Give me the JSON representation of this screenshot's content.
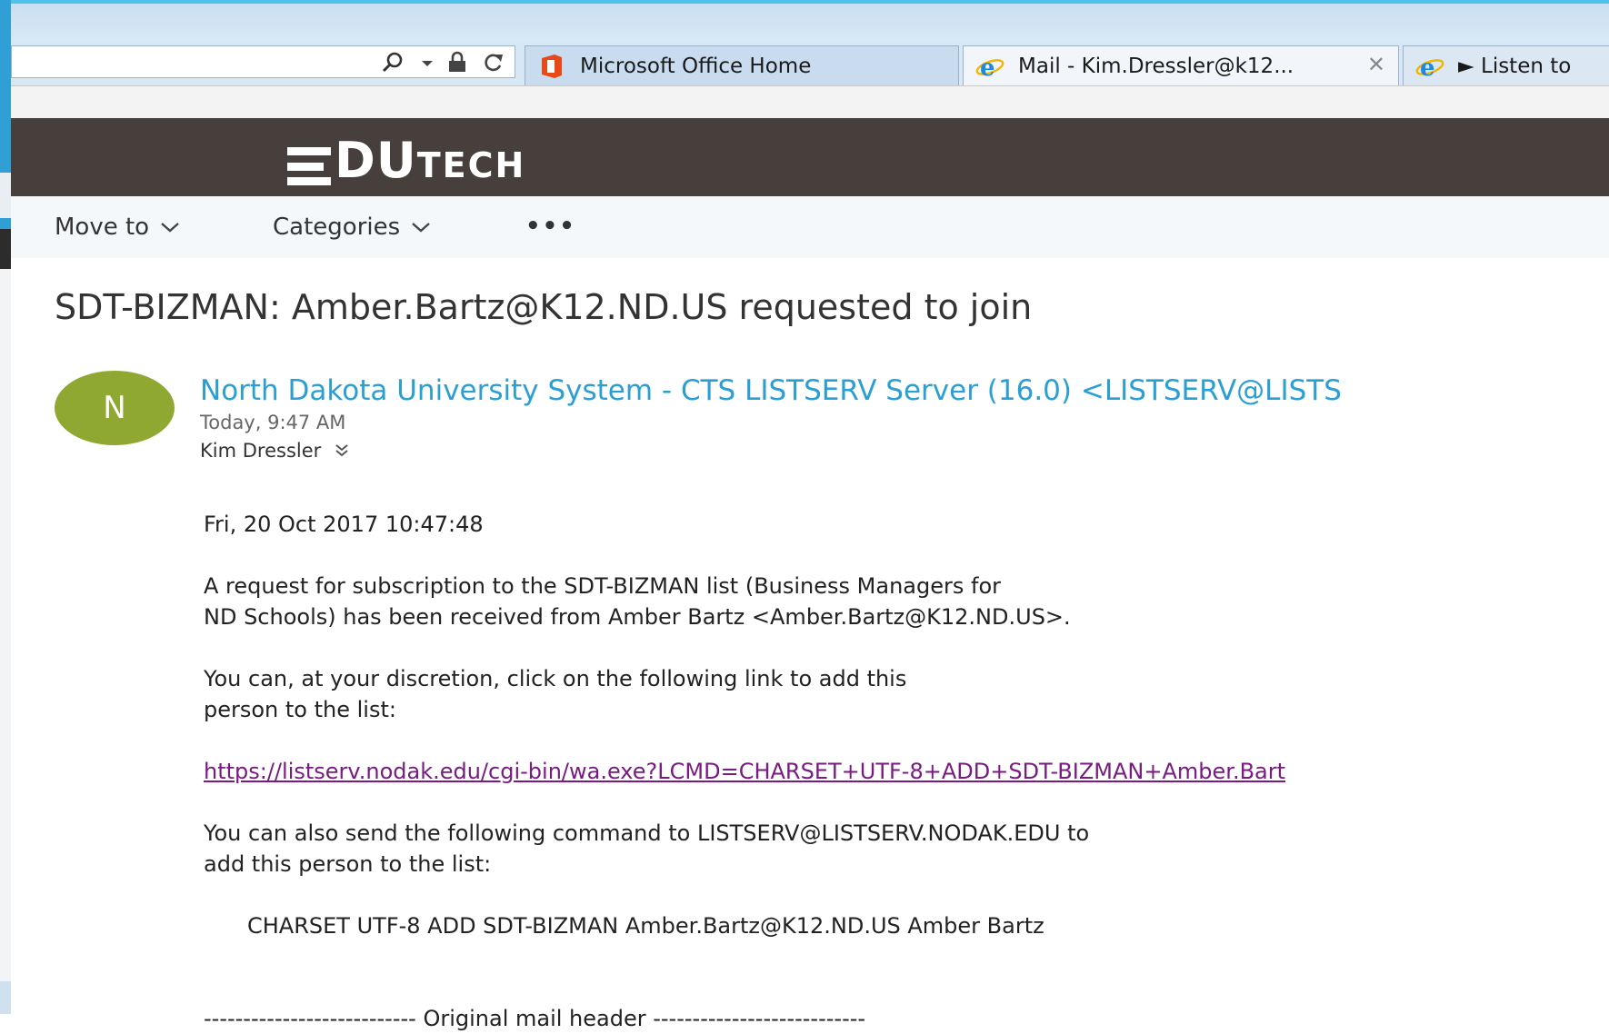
{
  "browser": {
    "tabs": [
      {
        "label": "Microsoft Office Home",
        "icon": "office-icon"
      },
      {
        "label": "Mail - Kim.Dressler@k12...",
        "icon": "ie-icon",
        "close": "✕"
      },
      {
        "label": "► Listen to",
        "icon": "ie-icon"
      }
    ]
  },
  "brand": {
    "logo_big": "DU",
    "logo_small": "TECH"
  },
  "toolbar": {
    "move_to": "Move to",
    "categories": "Categories",
    "more": "•••"
  },
  "message": {
    "subject": "SDT-BIZMAN: Amber.Bartz@K12.ND.US requested to join",
    "avatar_initial": "N",
    "sender": "North Dakota University System - CTS LISTSERV Server (16.0) <LISTSERV@LISTS",
    "time": "Today, 9:47 AM",
    "recipient": "Kim Dressler",
    "body": {
      "date": "Fri, 20 Oct 2017 10:47:48",
      "para1_line1": "A request for subscription to  the SDT-BIZMAN list (Business Managers for",
      "para1_line2": "ND Schools) has been received from Amber Bartz <Amber.Bartz@K12.ND.US>.",
      "para2_line1": "You can,  at your  discretion, click  on the following  link to  add this",
      "para2_line2": "person to the list:",
      "link": "https://listserv.nodak.edu/cgi-bin/wa.exe?LCMD=CHARSET+UTF-8+ADD+SDT-BIZMAN+Amber.Bart",
      "para3_line1": "You can also send the following command to LISTSERV@LISTSERV.NODAK.EDU to",
      "para3_line2": "add this person to the list:",
      "command": "CHARSET UTF-8 ADD SDT-BIZMAN Amber.Bartz@K12.ND.US Amber Bartz",
      "header_divider": "--------------------------- Original mail header ---------------------------"
    }
  },
  "colors": {
    "brand_band": "#463f3b",
    "sender_link": "#2a9fd6",
    "avatar": "#8fa832",
    "visited_link": "#7a1a83"
  }
}
